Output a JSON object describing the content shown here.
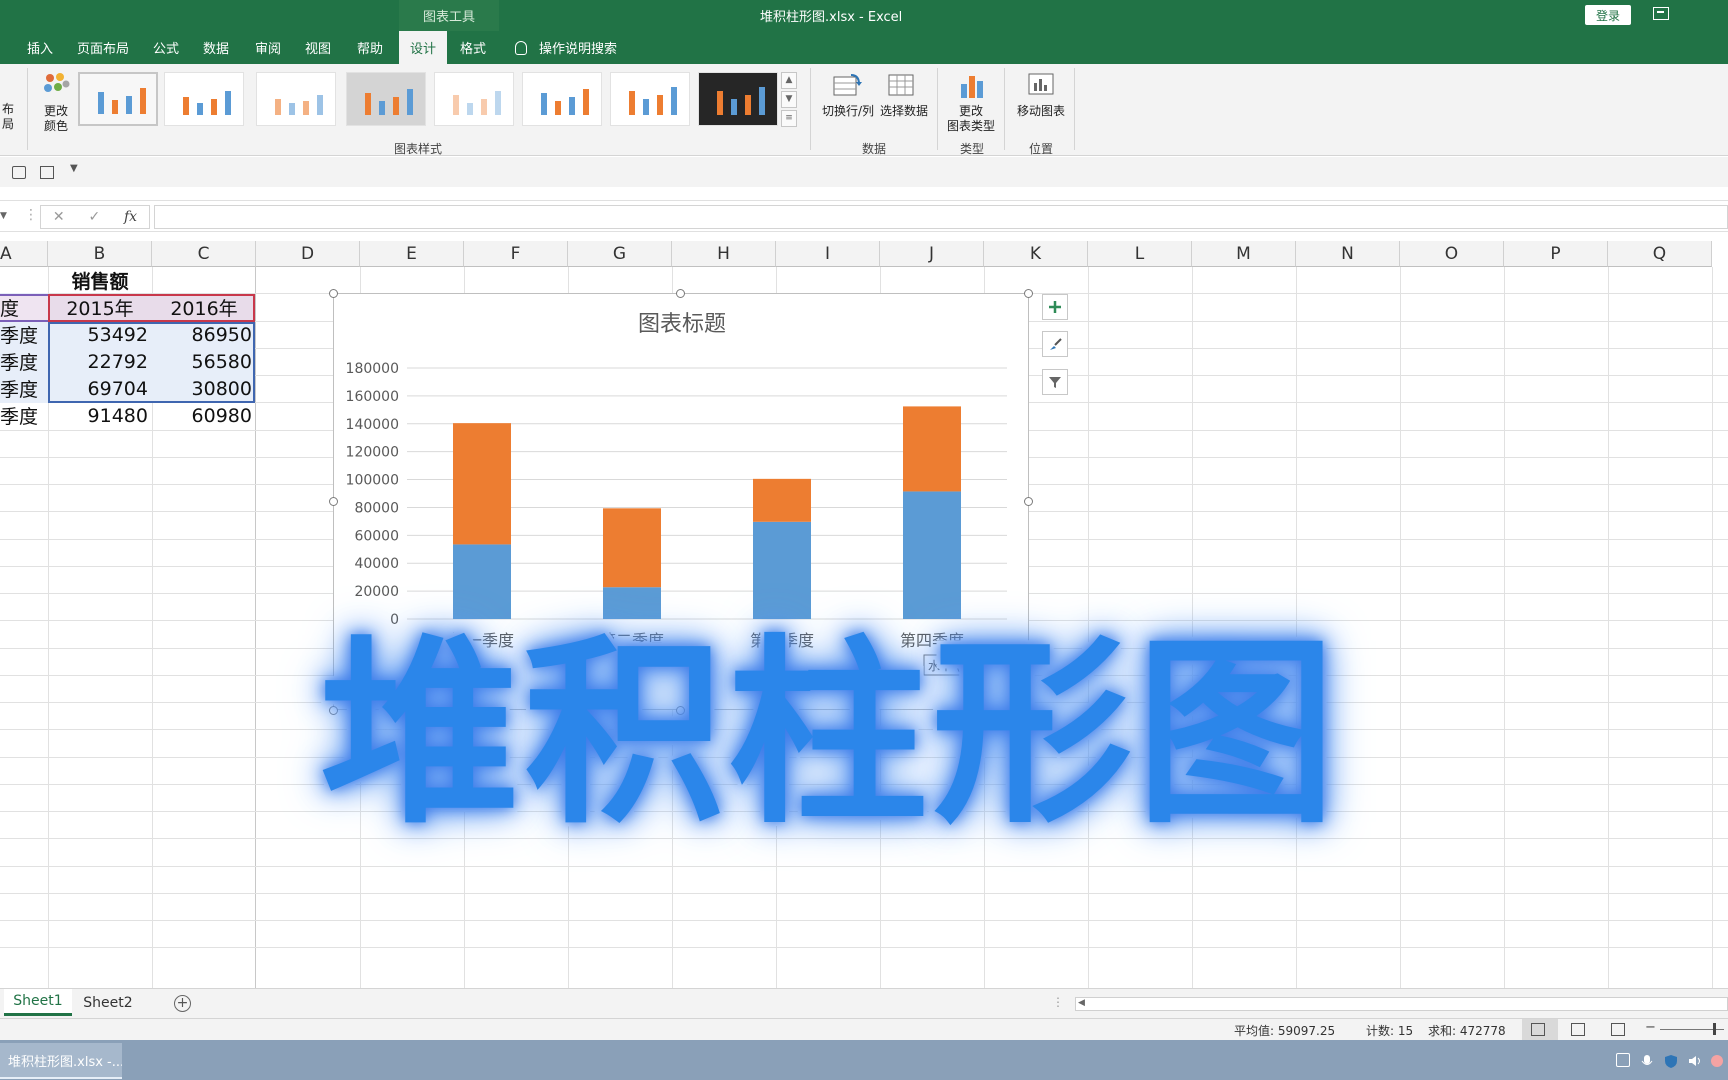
{
  "window": {
    "context_tools": "图表工具",
    "title": "堆积柱形图.xlsx  -  Excel",
    "login": "登录"
  },
  "tabs": [
    {
      "label": "插入"
    },
    {
      "label": "页面布局"
    },
    {
      "label": "公式"
    },
    {
      "label": "数据"
    },
    {
      "label": "审阅"
    },
    {
      "label": "视图"
    },
    {
      "label": "帮助"
    },
    {
      "label": "设计",
      "active": true
    },
    {
      "label": "格式"
    }
  ],
  "tell_me": "操作说明搜索",
  "ribbon": {
    "layout_fragment": "布局",
    "change_colors": "更改",
    "change_colors_2": "颜色",
    "chart_styles_label": "图表样式",
    "switch_row_col": "切换行/列",
    "select_data": "选择数据",
    "data_label": "数据",
    "change_type": "更改",
    "change_type_2": "图表类型",
    "type_label": "类型",
    "move_chart": "移动图表",
    "location_label": "位置"
  },
  "formula_bar": {
    "fx": "fx",
    "cancel": "✕",
    "enter": "✓"
  },
  "columns": [
    "A",
    "B",
    "C",
    "D",
    "E",
    "F",
    "G",
    "H",
    "I",
    "J",
    "K",
    "L",
    "M",
    "N",
    "O",
    "P",
    "Q"
  ],
  "table": {
    "title": "销售额",
    "header_a": "度",
    "header_b": "2015年",
    "header_c": "2016年",
    "rows": [
      {
        "a": "季度",
        "b": "53492",
        "c": "86950"
      },
      {
        "a": "季度",
        "b": "22792",
        "c": "56580"
      },
      {
        "a": "季度",
        "b": "69704",
        "c": "30800"
      },
      {
        "a": "季度",
        "b": "91480",
        "c": "60980"
      }
    ]
  },
  "chart_data": {
    "type": "bar",
    "stacked": true,
    "title": "图表标题",
    "categories": [
      "第一季度",
      "第二季度",
      "第三季度",
      "第四季度"
    ],
    "series": [
      {
        "values": [
          53492,
          22792,
          69704,
          91480
        ],
        "color": "#5b9bd5"
      },
      {
        "values": [
          86950,
          56580,
          30800,
          60980
        ],
        "color": "#ed7d31"
      }
    ],
    "ylim": [
      0,
      180000
    ],
    "yticks": [
      "0",
      "20000",
      "40000",
      "60000",
      "80000",
      "100000",
      "120000",
      "140000",
      "160000",
      "180000"
    ],
    "grid": true,
    "hover_tooltip": "水平 (类别)"
  },
  "overlay_caption": "堆积柱形图",
  "sheets": [
    {
      "label": "Sheet1",
      "active": true
    },
    {
      "label": "Sheet2"
    }
  ],
  "status": {
    "average": "平均值: 59097.25",
    "count": "计数: 15",
    "sum": "求和: 472778"
  },
  "taskbar": {
    "item": "堆积柱形图.xlsx -..."
  }
}
